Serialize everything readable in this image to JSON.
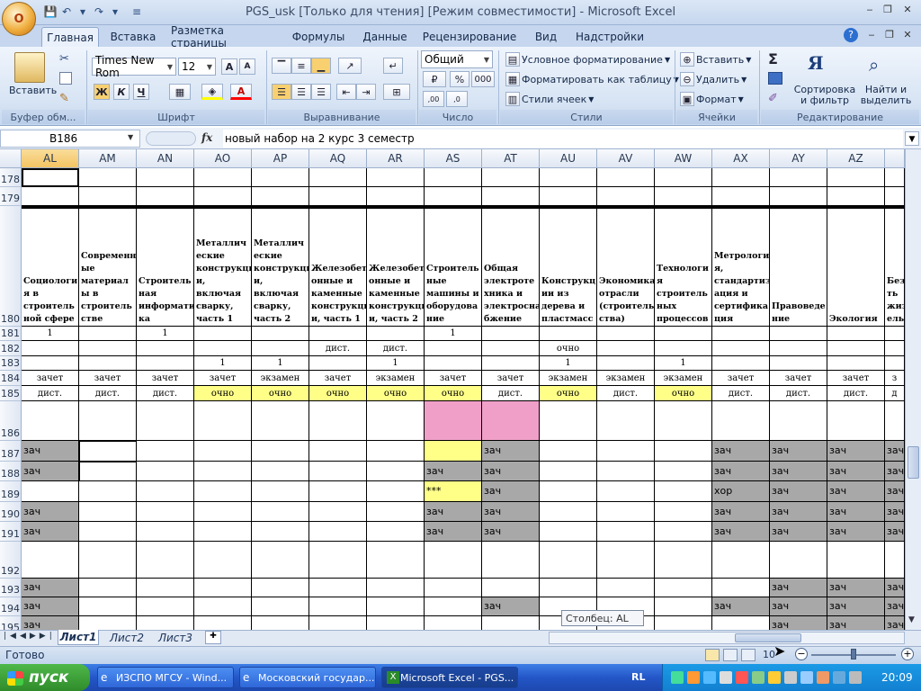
{
  "window": {
    "title": "PGS_usk  [Только для чтения]  [Режим совместимости] - Microsoft Excel",
    "office_label": "O"
  },
  "ribbon_tabs": [
    "Главная",
    "Вставка",
    "Разметка страницы",
    "Формулы",
    "Данные",
    "Рецензирование",
    "Вид",
    "Надстройки"
  ],
  "groups": {
    "clipboard": "Буфер обм...",
    "font": "Шрифт",
    "alignment": "Выравнивание",
    "number": "Число",
    "styles": "Стили",
    "cells": "Ячейки",
    "editing": "Редактирование"
  },
  "clipboard": {
    "paste": "Вставить"
  },
  "font": {
    "name": "Times New Rom",
    "size": "12",
    "bold": "Ж",
    "italic": "К",
    "underline": "Ч"
  },
  "number": {
    "format": "Общий",
    "percent": "%",
    "thousands": "000"
  },
  "styles": {
    "conditional": "Условное форматирование",
    "table": "Форматировать как таблицу",
    "cell_styles": "Стили ячеек"
  },
  "cells": {
    "insert": "Вставить",
    "delete": "Удалить",
    "format": "Формат"
  },
  "editing": {
    "sum": "Σ",
    "sort": "Сортировка и фильтр",
    "sort_line1": "Сортировка",
    "sort_line2": "и фильтр",
    "find_line1": "Найти и",
    "find_line2": "выделить"
  },
  "formula": {
    "cell_ref": "B186",
    "fx": "fx",
    "value": "новый набор на 2 курс 3 семестр"
  },
  "columns": [
    "AL",
    "AM",
    "AN",
    "AO",
    "AP",
    "AQ",
    "AR",
    "AS",
    "AT",
    "AU",
    "AV",
    "AW",
    "AX",
    "AY",
    "AZ"
  ],
  "rows": [
    "178",
    "179",
    "180",
    "181",
    "182",
    "183",
    "184",
    "185",
    "186",
    "187",
    "188",
    "189",
    "190",
    "191",
    "192",
    "193",
    "194",
    "195"
  ],
  "subjects": [
    "Социология в строительной сфере",
    "Современные материалы в строительстве",
    "Строительная информатика",
    "Металлические конструкции, включая сварку, часть 1",
    "Металлические конструкции, включая сварку, часть 2",
    "Железобетонные и каменные конструкции, часть 1",
    "Железобетонные и каменные конструкции, часть 2",
    "Строительные машины и оборудование",
    "Общая электротехника и электроснабжение",
    "Конструкции из дерева и пластмасс",
    "Экономика отрасли (строительства)",
    "Технология строительных процессов",
    "Метрология, стандартизация и сертификация",
    "Правоведение",
    "Экология",
    "Безопасность жизнедеятельности"
  ],
  "subject_lines": [
    [
      "Социологи",
      "я в",
      "строитель",
      "ной сфере"
    ],
    [
      "Современн",
      "ые",
      "материал",
      "ы в",
      "строитель",
      "стве"
    ],
    [
      "Строитель",
      "ная",
      "информати",
      "ка"
    ],
    [
      "Металлич",
      "еские",
      "конструкци",
      "и, включая",
      "сварку,",
      "часть 1"
    ],
    [
      "Металлич",
      "еские",
      "конструкци",
      "и, включая",
      "сварку,",
      "часть 2"
    ],
    [
      "Железобет",
      "онные и",
      "каменные",
      "конструкци",
      "и, часть 1"
    ],
    [
      "Железобет",
      "онные и",
      "каменные",
      "конструкци",
      "и, часть 2"
    ],
    [
      "Строитель",
      "ные",
      "машины и",
      "оборудова",
      "ние"
    ],
    [
      "Общая",
      "электроте",
      "хника и",
      "электросна",
      "бжение"
    ],
    [
      "Конструкц",
      "ии из",
      "дерева и",
      "пластмасс"
    ],
    [
      "Экономика",
      "отрасли",
      "(строитель",
      "ства)"
    ],
    [
      "Технологи",
      "я",
      "строитель",
      "ных",
      "процессов"
    ],
    [
      "Метрологи",
      "я,",
      "стандартиз",
      "ация и",
      "сертифика",
      "ция"
    ],
    [
      "Правоведе",
      "ние"
    ],
    [
      "Экология"
    ],
    [
      "Без",
      "ть",
      "жиз",
      "ель"
    ]
  ],
  "row181": [
    "1",
    "",
    "1",
    "",
    "",
    "",
    "",
    "1",
    "",
    "",
    "",
    "",
    "",
    "",
    "",
    ""
  ],
  "row182": [
    "",
    "",
    "",
    "",
    "",
    "дист.",
    "дист.",
    "",
    "",
    "очно",
    "",
    "",
    "",
    "",
    "",
    ""
  ],
  "row183": [
    "",
    "",
    "",
    "1",
    "1",
    "",
    "1",
    "",
    "",
    "1",
    "",
    "1",
    "",
    "",
    "",
    ""
  ],
  "row184": [
    "зачет",
    "зачет",
    "зачет",
    "зачет",
    "экзамен",
    "зачет",
    "экзамен",
    "зачет",
    "зачет",
    "экзамен",
    "экзамен",
    "экзамен",
    "зачет",
    "зачет",
    "зачет",
    "з"
  ],
  "row185": [
    "дист.",
    "дист.",
    "дист.",
    "очно",
    "очно",
    "очно",
    "очно",
    "очно",
    "дист.",
    "очно",
    "дист.",
    "очно",
    "дист.",
    "дист.",
    "дист.",
    "д"
  ],
  "row187": [
    "зач",
    "",
    "",
    "",
    "",
    "",
    "",
    "",
    "зач",
    "",
    "",
    "",
    "зач",
    "зач",
    "зач",
    "зач"
  ],
  "row188": [
    "зач",
    "",
    "",
    "",
    "",
    "",
    "",
    "зач",
    "зач",
    "",
    "",
    "",
    "зач",
    "зач",
    "зач",
    "зач"
  ],
  "row189": [
    "",
    "",
    "",
    "",
    "",
    "",
    "",
    "***",
    "зач",
    "",
    "",
    "",
    "хор",
    "зач",
    "зач",
    "зач"
  ],
  "row190": [
    "зач",
    "",
    "",
    "",
    "",
    "",
    "",
    "зач",
    "зач",
    "",
    "",
    "",
    "зач",
    "зач",
    "зач",
    "зач"
  ],
  "row191": [
    "зач",
    "",
    "",
    "",
    "",
    "",
    "",
    "зач",
    "зач",
    "",
    "",
    "",
    "зач",
    "зач",
    "зач",
    "зач"
  ],
  "row193": [
    "зач",
    "",
    "",
    "",
    "",
    "",
    "",
    "",
    "",
    "",
    "",
    "",
    "",
    "зач",
    "зач",
    "зач"
  ],
  "row194": [
    "зач",
    "",
    "",
    "",
    "",
    "",
    "",
    "",
    "зач",
    "",
    "",
    "",
    "зач",
    "зач",
    "зач",
    "зач"
  ],
  "row195": [
    "зач",
    "",
    "",
    "",
    "",
    "",
    "",
    "",
    "",
    "",
    "",
    "",
    "",
    "зач",
    "зач",
    "зач"
  ],
  "tooltip": "Столбец: AL",
  "sheets": [
    "Лист1",
    "Лист2",
    "Лист3"
  ],
  "status": {
    "ready": "Готово",
    "zoom": "10"
  },
  "taskbar": {
    "start": "пуск",
    "tasks": [
      "ИЗСПО МГСУ - Wind...",
      "Московский государ...",
      "Microsoft Excel - PGS..."
    ],
    "lang": "RL",
    "time": "20:09"
  },
  "colors": {
    "yellow": "#ffff88",
    "pink": "#f0a0c8",
    "gray": "#a8a8a8"
  }
}
